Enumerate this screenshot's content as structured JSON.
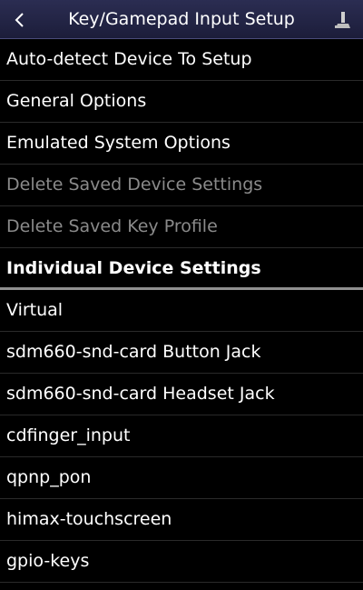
{
  "header": {
    "title": "Key/Gamepad Input Setup",
    "back_icon": "chevron-left-icon",
    "action_icon": "joystick-icon"
  },
  "menu": {
    "items": [
      {
        "label": "Auto-detect Device To Setup",
        "enabled": true
      },
      {
        "label": "General Options",
        "enabled": true
      },
      {
        "label": "Emulated System Options",
        "enabled": true
      },
      {
        "label": "Delete Saved Device Settings",
        "enabled": false
      },
      {
        "label": "Delete Saved Key Profile",
        "enabled": false
      }
    ]
  },
  "section": {
    "title": "Individual Device Settings"
  },
  "devices": {
    "items": [
      {
        "label": "Virtual"
      },
      {
        "label": "sdm660-snd-card Button Jack"
      },
      {
        "label": "sdm660-snd-card Headset Jack"
      },
      {
        "label": "cdfinger_input"
      },
      {
        "label": "qpnp_pon"
      },
      {
        "label": "himax-touchscreen"
      },
      {
        "label": "gpio-keys"
      }
    ]
  },
  "colors": {
    "header_bg": "#23244a",
    "background": "#000000",
    "text": "#ffffff",
    "disabled_text": "#8a8a8a",
    "divider": "#2a2a2a",
    "section_divider": "#8f8f8f"
  }
}
